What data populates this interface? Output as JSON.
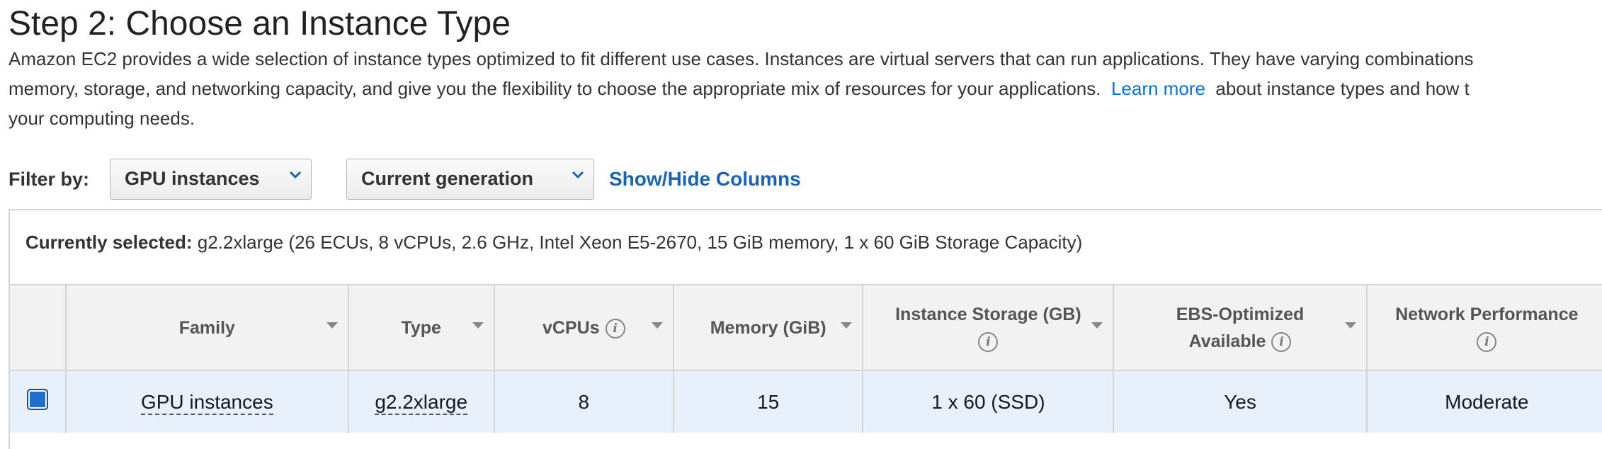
{
  "header": {
    "title": "Step 2: Choose an Instance Type",
    "description_line1": "Amazon EC2 provides a wide selection of instance types optimized to fit different use cases. Instances are virtual servers that can run applications. They have varying combinations",
    "description_line2_before": "memory, storage, and networking capacity, and give you the flexibility to choose the appropriate mix of resources for your applications.",
    "learn_more_link": "Learn more",
    "description_line2_after": "about instance types and how t",
    "description_line3": "your computing needs."
  },
  "filters": {
    "label": "Filter by:",
    "family_select": "GPU instances",
    "generation_select": "Current generation",
    "show_hide_columns": "Show/Hide Columns"
  },
  "selection": {
    "label": "Currently selected:",
    "summary": "g2.2xlarge (26 ECUs, 8 vCPUs, 2.6 GHz, Intel Xeon E5-2670, 15 GiB memory, 1 x 60 GiB Storage Capacity)"
  },
  "table": {
    "columns": {
      "family": "Family",
      "type": "Type",
      "vcpus": "vCPUs",
      "memory": "Memory (GiB)",
      "storage": "Instance Storage (GB)",
      "ebs_line1": "EBS-Optimized",
      "ebs_line2": "Available",
      "network": "Network Performance"
    },
    "rows": [
      {
        "selected": true,
        "family": "GPU instances",
        "type": "g2.2xlarge",
        "vcpus": "8",
        "memory": "15",
        "storage": "1 x 60 (SSD)",
        "ebs": "Yes",
        "network": "Moderate"
      }
    ]
  },
  "icons": {
    "info": "i",
    "select_chevron": "chevron-down-icon",
    "sort": "sort-caret-icon"
  },
  "colors": {
    "link": "#0972d3",
    "selected_row": "#e8f1fb",
    "checkbox": "#1f6fd1"
  }
}
